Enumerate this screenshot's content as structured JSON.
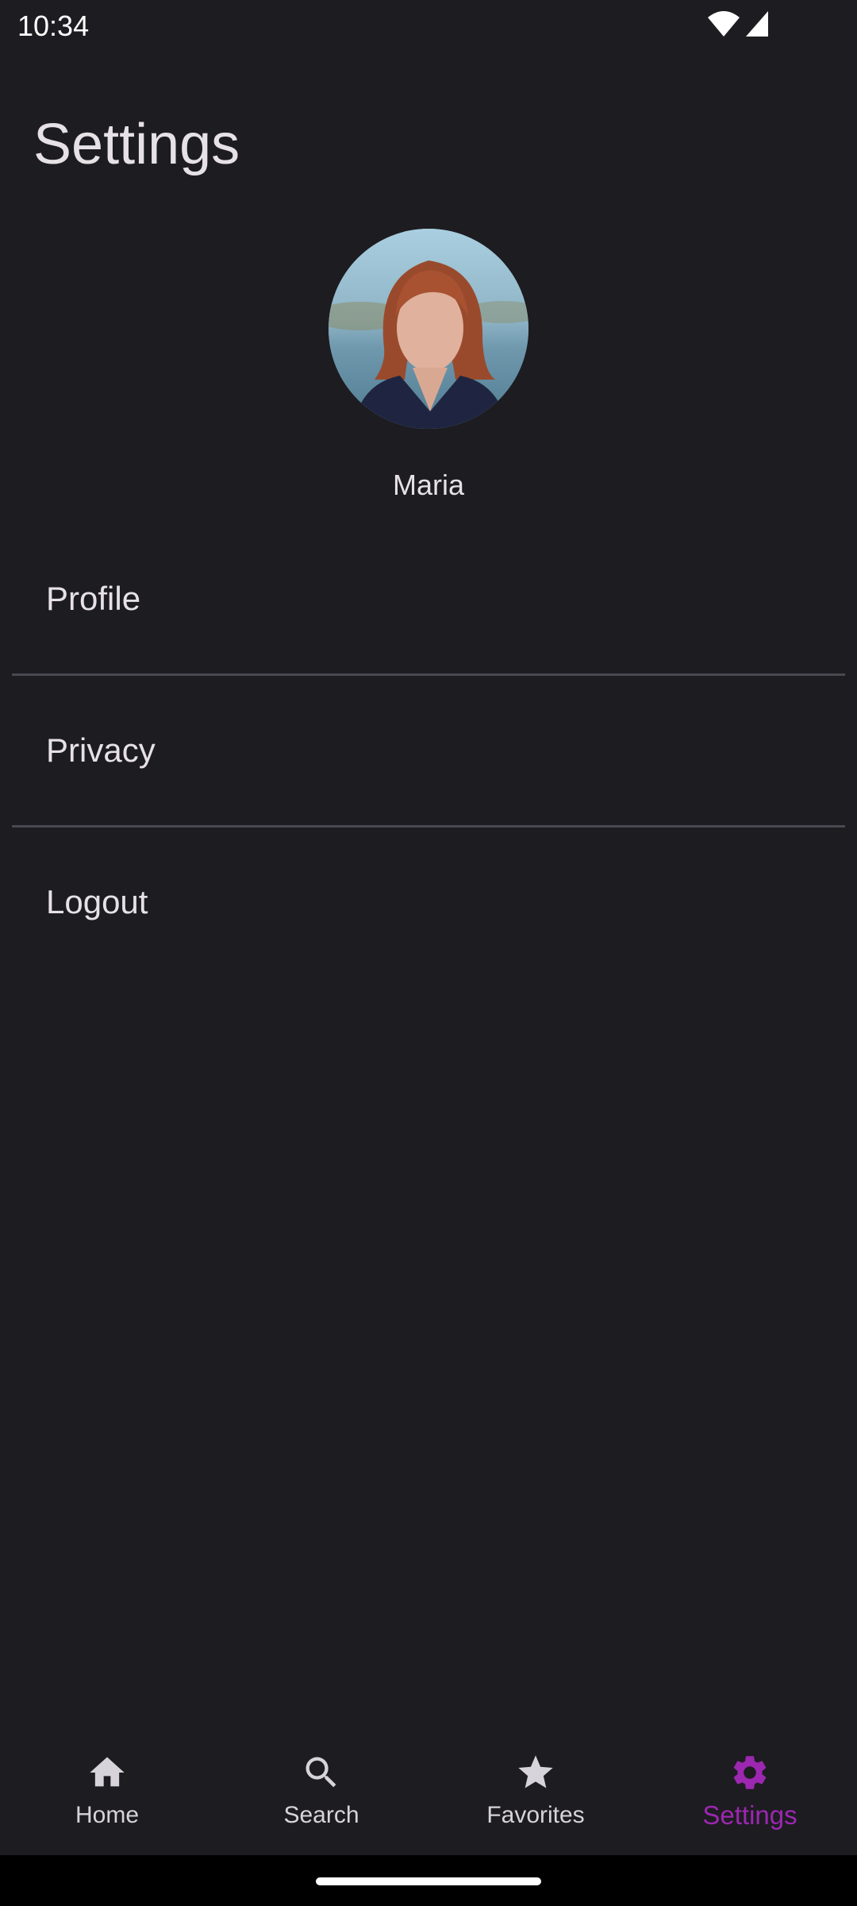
{
  "status_bar": {
    "time": "10:34",
    "icons": [
      "wifi-icon",
      "cell-signal-icon"
    ]
  },
  "page": {
    "title": "Settings"
  },
  "profile": {
    "name": "Maria"
  },
  "settings_items": [
    {
      "label": "Profile"
    },
    {
      "label": "Privacy"
    },
    {
      "label": "Logout"
    }
  ],
  "bottom_nav": {
    "items": [
      {
        "label": "Home",
        "icon": "home-icon"
      },
      {
        "label": "Search",
        "icon": "search-icon"
      },
      {
        "label": "Favorites",
        "icon": "star-icon"
      },
      {
        "label": "Settings",
        "icon": "gear-icon",
        "active": true
      }
    ]
  },
  "colors": {
    "background": "#1d1c21",
    "text": "#e6e1e5",
    "accent": "#9c27b0",
    "divider": "#4a4850"
  }
}
